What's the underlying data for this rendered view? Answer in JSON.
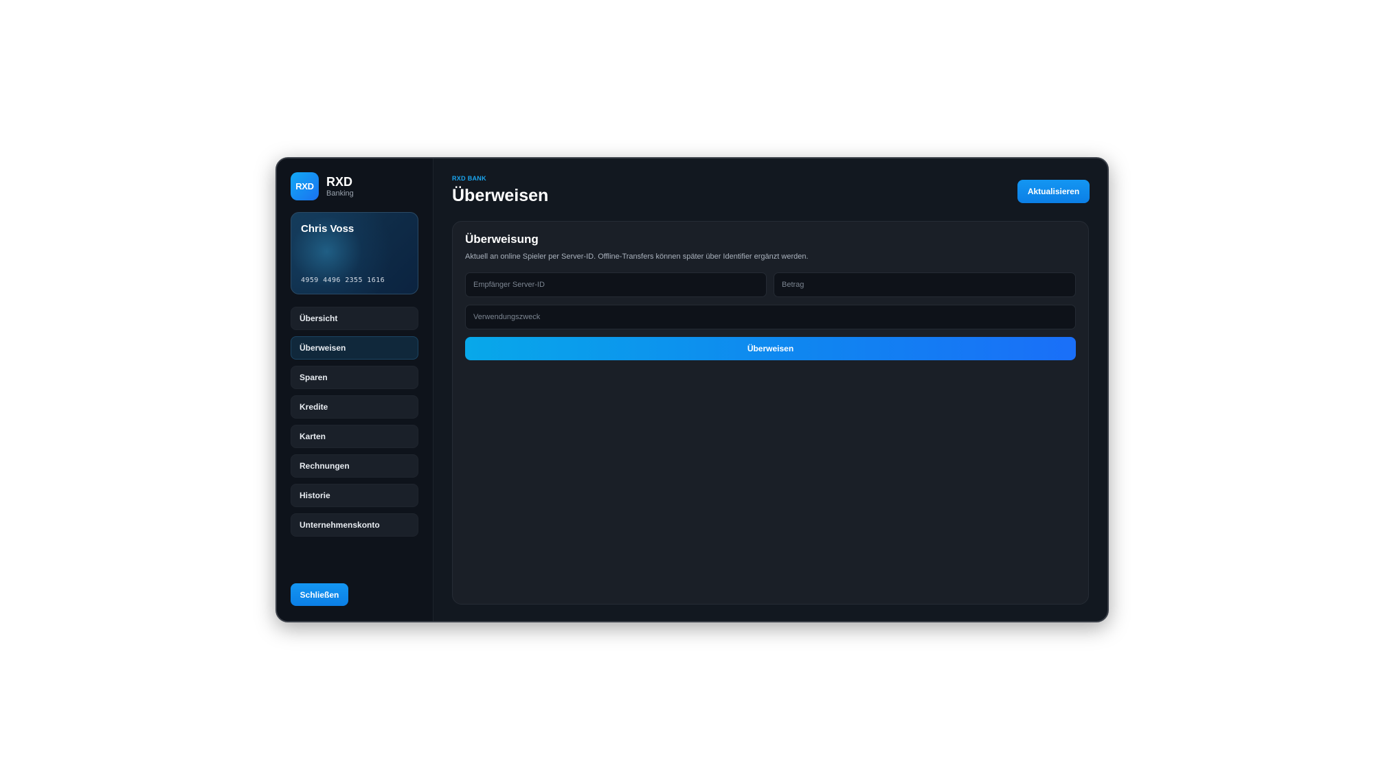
{
  "brand": {
    "logo": "RXD",
    "name": "RXD",
    "subtitle": "Banking"
  },
  "card": {
    "holder": "Chris Voss",
    "number": "4959 4496 2355 1616"
  },
  "sidebar": {
    "items": [
      {
        "label": "Übersicht",
        "active": false
      },
      {
        "label": "Überweisen",
        "active": true
      },
      {
        "label": "Sparen",
        "active": false
      },
      {
        "label": "Kredite",
        "active": false
      },
      {
        "label": "Karten",
        "active": false
      },
      {
        "label": "Rechnungen",
        "active": false
      },
      {
        "label": "Historie",
        "active": false
      },
      {
        "label": "Unternehmenskonto",
        "active": false
      }
    ],
    "close_label": "Schließen"
  },
  "header": {
    "eyebrow": "RXD BANK",
    "title": "Überweisen",
    "refresh_label": "Aktualisieren"
  },
  "transfer": {
    "title": "Überweisung",
    "description": "Aktuell an online Spieler per Server-ID. Offline-Transfers können später über Identifier ergänzt werden.",
    "server_id": {
      "value": "",
      "placeholder": "Empfänger Server-ID"
    },
    "amount": {
      "value": "",
      "placeholder": "Betrag"
    },
    "purpose": {
      "value": "",
      "placeholder": "Verwendungszweck"
    },
    "submit_label": "Überweisen"
  },
  "colors": {
    "accent": "#1496f2",
    "background": "#121820",
    "panel": "#1a1f27"
  }
}
